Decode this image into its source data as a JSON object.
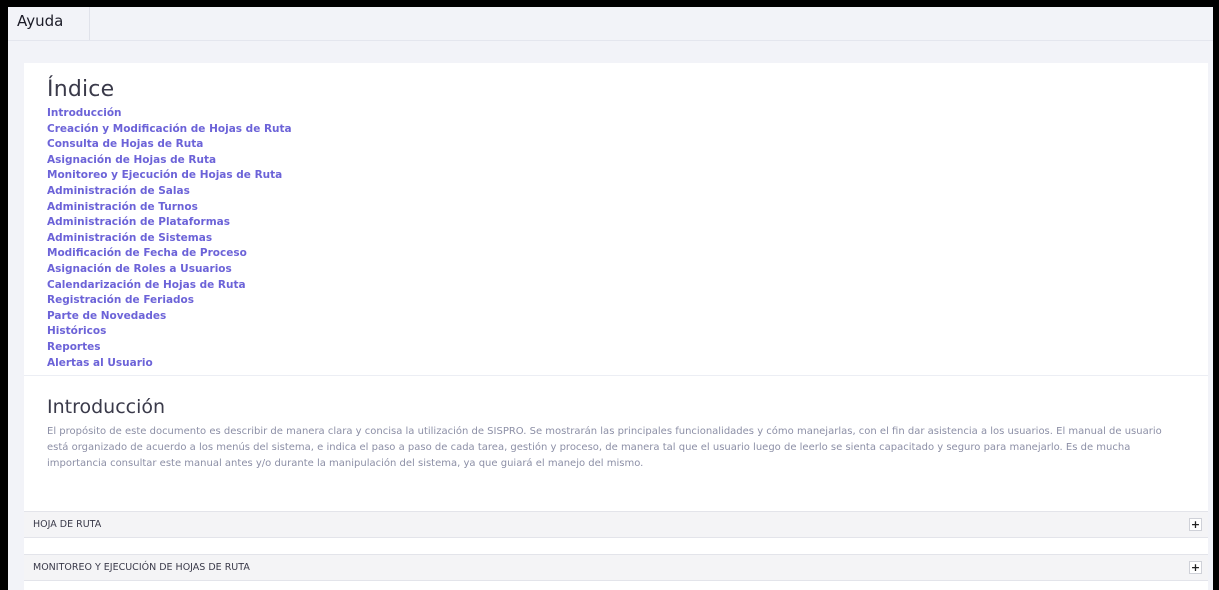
{
  "header": {
    "tab_label": "Ayuda"
  },
  "index": {
    "title": "Índice",
    "items": [
      "Introducción",
      "Creación y Modificación de Hojas de Ruta",
      "Consulta de Hojas de Ruta",
      "Asignación de Hojas de Ruta",
      "Monitoreo y Ejecución de Hojas de Ruta",
      "Administración de Salas",
      "Administración de Turnos",
      "Administración de Plataformas",
      "Administración de Sistemas",
      "Modificación de Fecha de Proceso",
      "Asignación de Roles a Usuarios",
      "Calendarización de Hojas de Ruta",
      "Registración de Feriados",
      "Parte de Novedades",
      "Históricos",
      "Reportes",
      "Alertas al Usuario"
    ]
  },
  "intro": {
    "title": "Introducción",
    "text": "El propósito de este documento es describir de manera clara y concisa la utilización de SISPRO. Se mostrarán las principales funcionalidades y cómo manejarlas, con el fin dar asistencia a los usuarios. El manual de usuario está organizado de acuerdo a los menús del sistema, e indica el paso a paso de cada tarea, gestión y proceso, de manera tal que el usuario luego de leerlo se sienta capacitado y seguro para manejarlo. Es de mucha importancia consultar este manual antes y/o durante la manipulación del sistema, ya que guiará el manejo del mismo."
  },
  "accordions": [
    {
      "label": "HOJA DE RUTA",
      "toggle": "+"
    },
    {
      "label": "MONITOREO Y EJECUCIÓN DE HOJAS DE RUTA",
      "toggle": "+"
    }
  ],
  "colors": {
    "link": "#6c63d8",
    "body_text": "#8c8fa6",
    "background": "#f2f3f8"
  }
}
